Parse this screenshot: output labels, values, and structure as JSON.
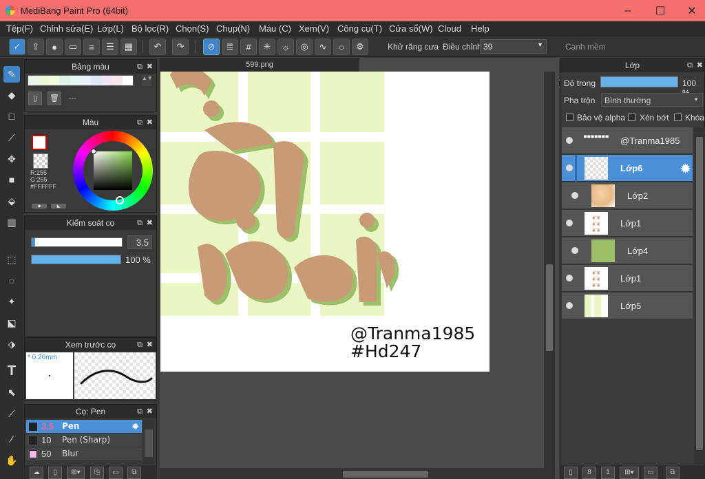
{
  "app": {
    "title": "MediBang Paint Pro (64bit)"
  },
  "window_controls": {
    "minimize": "–",
    "maximize": "☐",
    "close": "✕"
  },
  "menu": [
    "Tệp(F)",
    "Chỉnh sửa(E)",
    "Lớp(L)",
    "Bộ lọc(R)",
    "Chọn(S)",
    "Chụp(N)",
    "Màu (C)",
    "Xem(V)",
    "Công cụ(T)",
    "Cửa sổ(W)",
    "Cloud",
    "Help"
  ],
  "toolbar": {
    "antialias_label": "Khử răng cưa",
    "adjust_label": "Điều chỉnh",
    "adjust_value": "39",
    "soft_edge_label": "Cạnh mềm",
    "antialias_checked": "✕"
  },
  "palette_panel": {
    "title": "Bảng màu",
    "dash": "---"
  },
  "color_panel": {
    "title": "Màu",
    "r": "R:255",
    "g": "G:255",
    "hex": "#FFFFFF"
  },
  "brush_control": {
    "title": "Kiểm soát cọ",
    "size": "3.5",
    "opacity": "100 %"
  },
  "brush_preview": {
    "title": "Xem trước cọ",
    "size_label": "* 0.26mm"
  },
  "brush_list": {
    "title": "Cọ: Pen",
    "items": [
      {
        "size": "3.5",
        "name": "Pen",
        "color": "#222222"
      },
      {
        "size": "10",
        "name": "Pen (Sharp)",
        "color": "#222222"
      },
      {
        "size": "50",
        "name": "Blur",
        "color": "#f7b8f0"
      }
    ]
  },
  "document": {
    "tab": "599.png",
    "watermark1": "@Tranma1985",
    "watermark2": "#Hd247"
  },
  "layer_panel": {
    "title": "Lớp",
    "opacity_label": "Độ trong",
    "opacity_value": "100 %",
    "blend_label": "Pha trộn",
    "blend_value": "Bình thường",
    "protect_alpha": "Bảo vệ alpha",
    "clip": "Xén bớt",
    "lock": "Khóa",
    "layers": [
      {
        "name": "@Tranma1985"
      },
      {
        "name": "Lớp6"
      },
      {
        "name": "Lớp2"
      },
      {
        "name": "Lớp1"
      },
      {
        "name": "Lớp4"
      },
      {
        "name": "Lớp1"
      },
      {
        "name": "Lớp5"
      }
    ]
  },
  "colors": {
    "accent": "#4a90d9",
    "titlebar": "#f66f6f",
    "canvas_letter": "#c89a76",
    "canvas_shadow": "#9dbf6a",
    "canvas_bg_grid": "#eaf7c4"
  }
}
